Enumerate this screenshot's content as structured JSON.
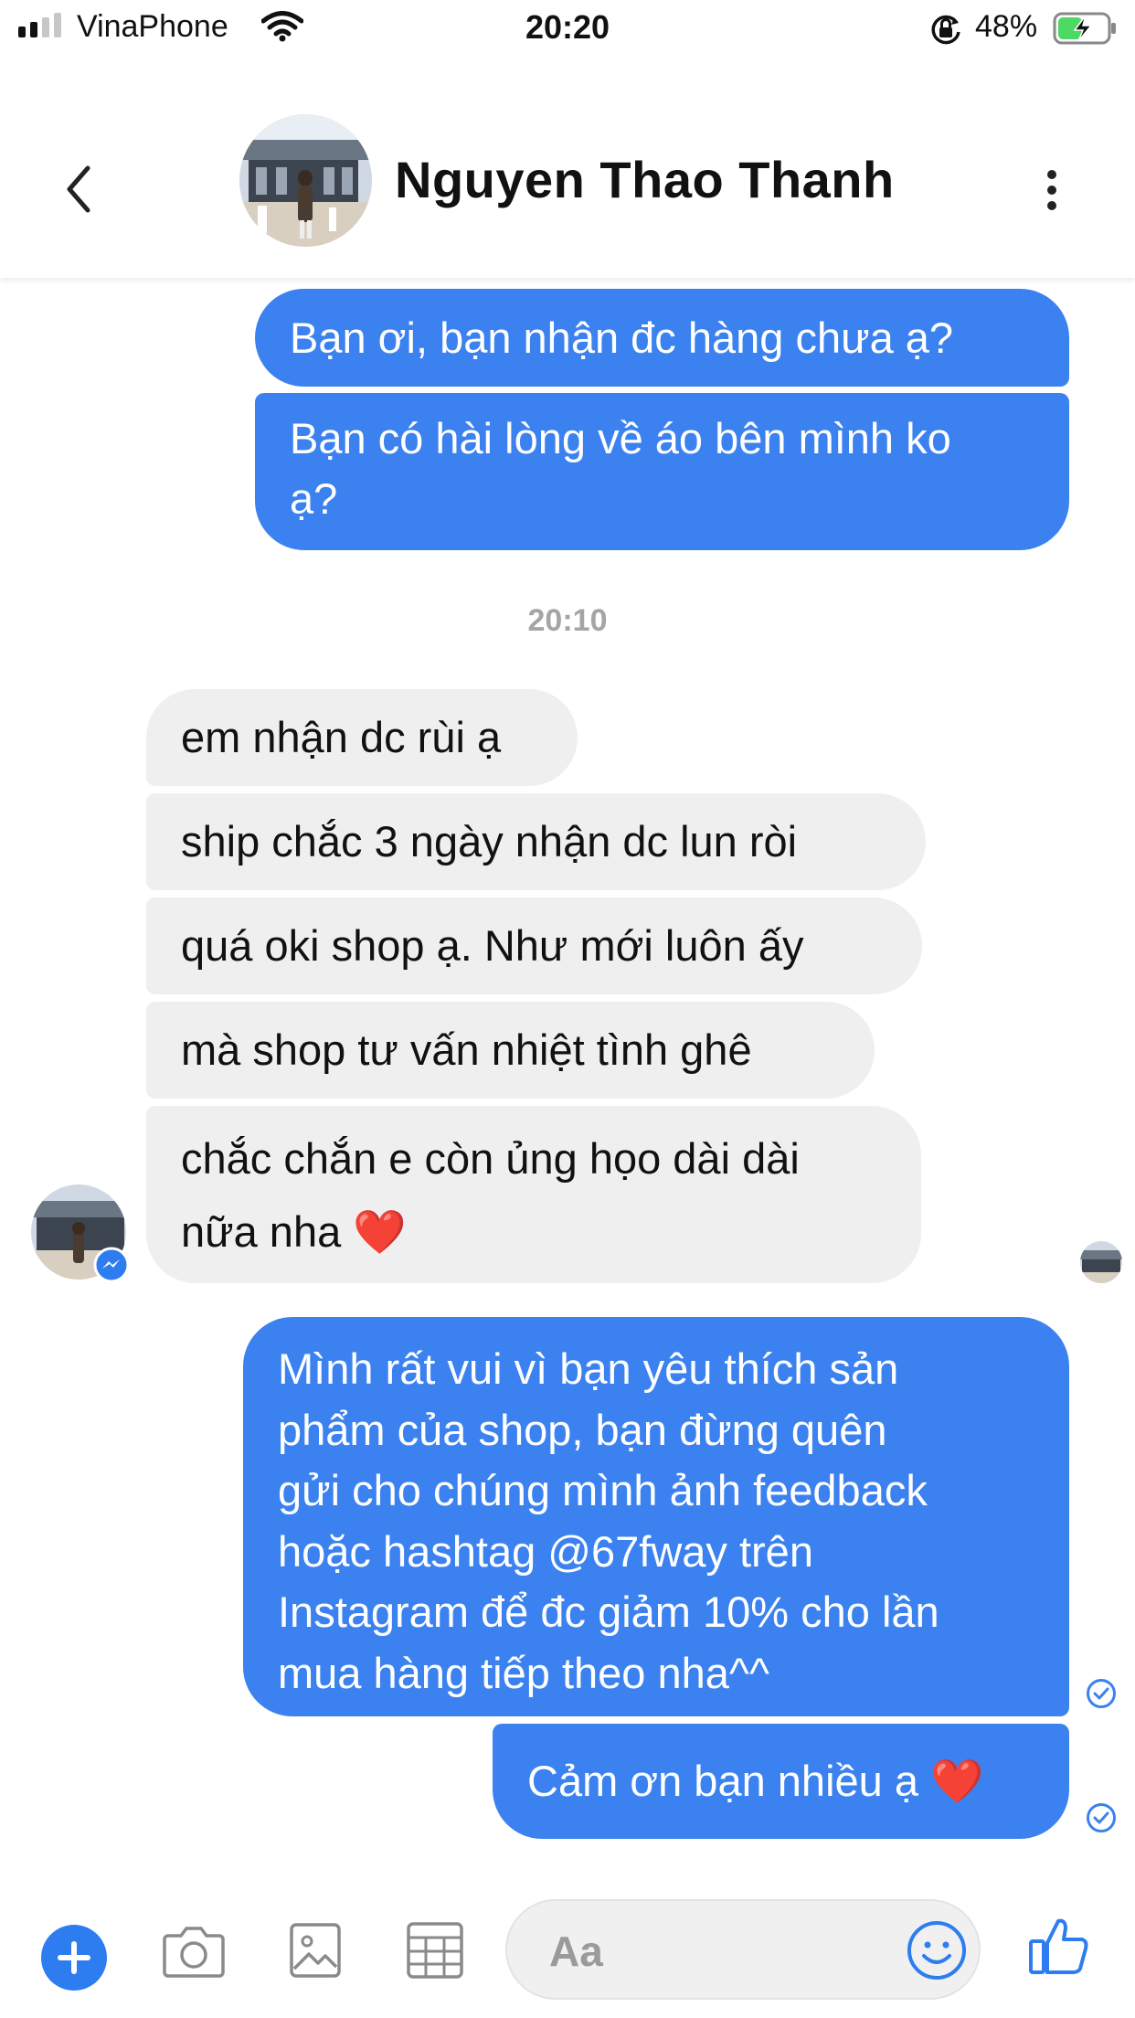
{
  "status_bar": {
    "carrier": "VinaPhone",
    "time": "20:20",
    "battery": "48%",
    "signal_bars": 2,
    "battery_level": 0.48
  },
  "header": {
    "contact_name": "Nguyen Thao Thanh",
    "back_icon": "chevron-left-icon",
    "more_icon": "vertical-ellipsis-icon"
  },
  "messages": {
    "outgoing_1": "Bạn ơi, bạn nhận đc hàng chưa ạ?",
    "outgoing_2_line1": "Bạn có hài lòng về áo bên mình ko",
    "outgoing_2_line2": "ạ?",
    "timestamp": "20:10",
    "incoming_1": "em nhận dc rùi ạ",
    "incoming_2": "ship chắc 3 ngày nhận dc lun ròi",
    "incoming_3": "quá oki shop ạ. Như mới luôn ấy",
    "incoming_4": "mà shop tư vấn nhiệt tình ghê",
    "incoming_5_line1": "chắc chắn e còn ủng họo dài dài",
    "incoming_5_line2": "nữa nha ❤️",
    "outgoing_3_lines": [
      "Mình rất vui vì bạn yêu thích sản",
      "phẩm của shop, bạn đừng quên",
      "gửi cho chúng mình ảnh feedback",
      "hoặc hashtag @67fway trên",
      "Instagram để đc giảm 10% cho lần",
      "mua hàng tiếp theo nha^^"
    ],
    "outgoing_4": "Cảm ơn bạn nhiều ạ ❤️"
  },
  "composer": {
    "placeholder": "Aa",
    "icons": [
      "plus-icon",
      "camera-icon",
      "photo-icon",
      "sticker-icon",
      "emoji-icon",
      "thumbs-up-icon"
    ]
  },
  "colors": {
    "outgoing_bubble": "#3b82f0",
    "incoming_bubble": "#efefef",
    "accent": "#2d7df0",
    "timestamp": "#a5a5a5"
  }
}
